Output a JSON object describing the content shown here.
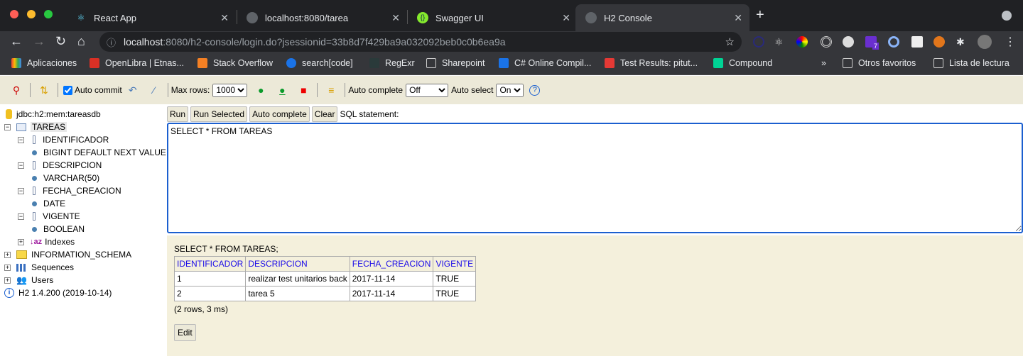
{
  "browser": {
    "tabs": [
      {
        "label": "React App",
        "icon": "react-icon"
      },
      {
        "label": "localhost:8080/tarea",
        "icon": "globe-icon"
      },
      {
        "label": "Swagger UI",
        "icon": "swagger-icon"
      },
      {
        "label": "H2 Console",
        "icon": "globe-icon",
        "active": true
      }
    ],
    "url_host": "localhost",
    "url_rest": ":8080/h2-console/login.do?jsessionid=33b8d7f429ba9a032092beb0c0b6ea9a",
    "extension_badge": "7",
    "bookmarks": [
      "Aplicaciones",
      "OpenLibra | Etnas...",
      "Stack Overflow",
      "search[code]",
      "RegExr",
      "Sharepoint",
      "C# Online Compil...",
      "Test Results: pitut...",
      "Compound"
    ],
    "other_bookmarks": "Otros favoritos",
    "reading_list": "Lista de lectura"
  },
  "toolbar": {
    "auto_commit": "Auto commit",
    "auto_commit_checked": true,
    "max_rows_label": "Max rows:",
    "max_rows": "1000",
    "auto_complete_label": "Auto complete",
    "auto_complete": "Off",
    "auto_select_label": "Auto select",
    "auto_select": "On",
    "help": "?"
  },
  "tree": {
    "connection": "jdbc:h2:mem:tareasdb",
    "table": "TAREAS",
    "columns": [
      {
        "name": "IDENTIFICADOR",
        "type": "BIGINT DEFAULT NEXT VALUE"
      },
      {
        "name": "DESCRIPCION",
        "type": "VARCHAR(50)"
      },
      {
        "name": "FECHA_CREACION",
        "type": "DATE"
      },
      {
        "name": "VIGENTE",
        "type": "BOOLEAN"
      }
    ],
    "indexes": "Indexes",
    "schema": "INFORMATION_SCHEMA",
    "sequences": "Sequences",
    "users": "Users",
    "version": "H2 1.4.200 (2019-10-14)"
  },
  "editor": {
    "run": "Run",
    "run_selected": "Run Selected",
    "auto_complete": "Auto complete",
    "clear": "Clear",
    "label": "SQL statement:",
    "sql": "SELECT * FROM TAREAS "
  },
  "result": {
    "query": "SELECT * FROM TAREAS;",
    "headers": [
      "IDENTIFICADOR",
      "DESCRIPCION",
      "FECHA_CREACION",
      "VIGENTE"
    ],
    "rows": [
      [
        "1",
        "realizar test unitarios back",
        "2017-11-14",
        "TRUE"
      ],
      [
        "2",
        "tarea 5",
        "2017-11-14",
        "TRUE"
      ]
    ],
    "summary": "(2 rows, 3 ms)",
    "edit": "Edit"
  }
}
